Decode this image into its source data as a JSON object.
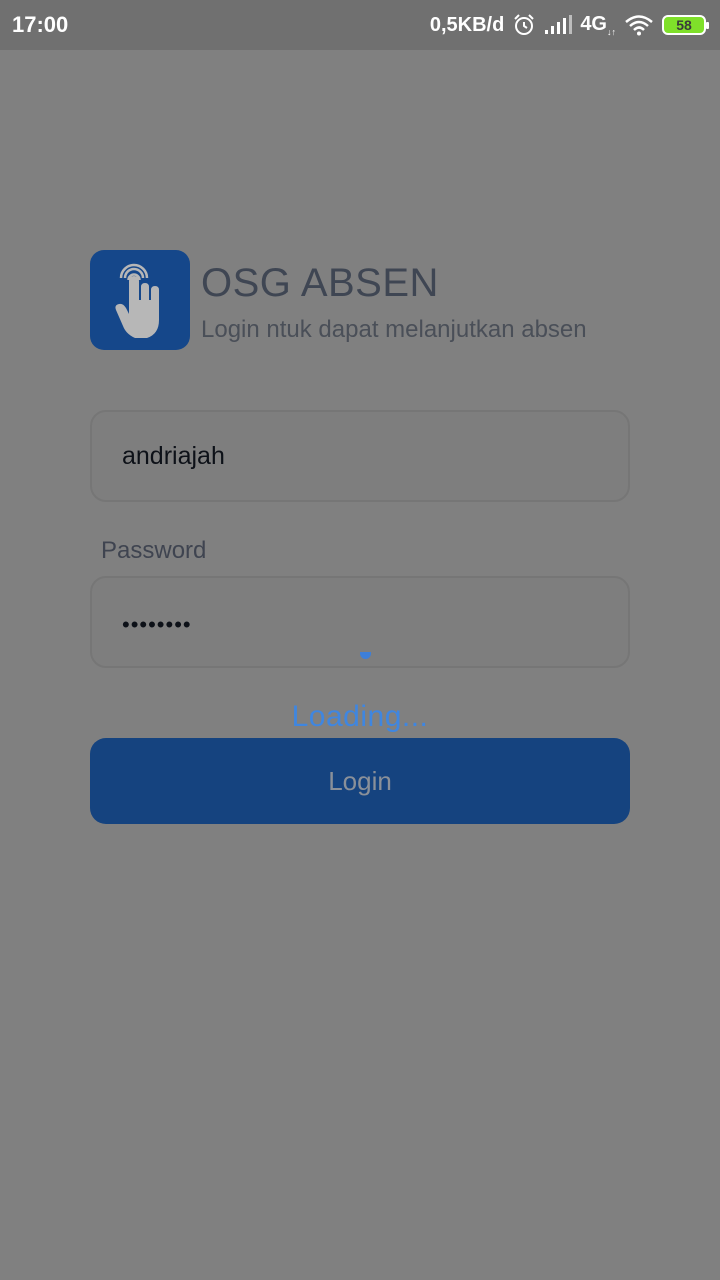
{
  "status_bar": {
    "time": "17:00",
    "network_speed": "0,5KB/d",
    "network_type": "4G",
    "network_sub": "↓↑",
    "battery_level": "58",
    "icons": [
      "alarm-icon",
      "signal-icon",
      "wifi-icon",
      "battery-icon"
    ],
    "battery_color": "#7fe02a"
  },
  "header": {
    "title": "OSG ABSEN",
    "subtitle": "Login ntuk dapat melanjutkan absen",
    "logo_icon": "touch-hand-icon",
    "logo_color": "#15478a"
  },
  "form": {
    "username_value": "andriajah",
    "password_label": "Password",
    "password_value": "••••••••",
    "loading_text": "Loading...",
    "login_button": "Login",
    "accent_color": "#3f86e0"
  }
}
